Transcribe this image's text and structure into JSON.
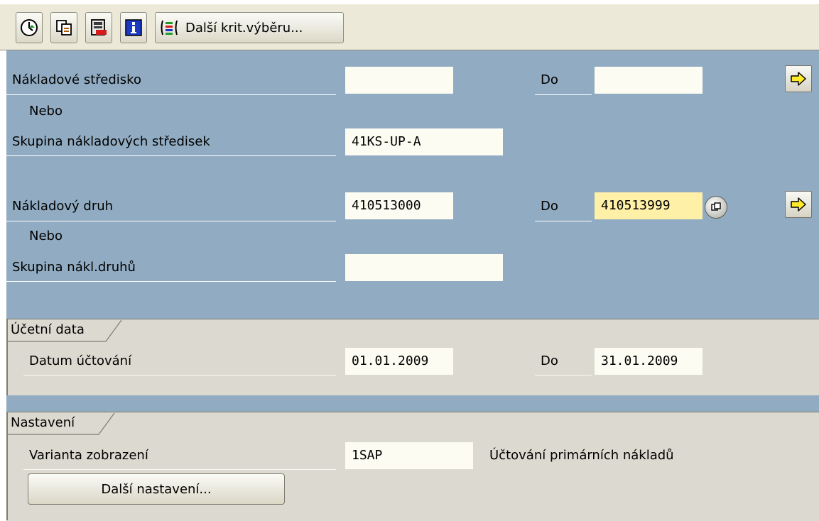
{
  "toolbar": {
    "buttons": [
      {
        "icon": "execute-clock-icon"
      },
      {
        "icon": "copy-variant-icon"
      },
      {
        "icon": "save-variant-icon"
      },
      {
        "icon": "info-icon"
      }
    ],
    "dynamic_selection_label": "Další krit.výběru..."
  },
  "selection": {
    "cost_center": {
      "label": "Nákladové středisko",
      "from": "",
      "to_label": "Do",
      "to": ""
    },
    "or1": "Nebo",
    "cost_center_group": {
      "label": "Skupina nákladových středisek",
      "value": "41KS-UP-A"
    },
    "cost_element": {
      "label": "Nákladový druh",
      "from": "410513000",
      "to_label": "Do",
      "to": "410513999"
    },
    "or2": "Nebo",
    "cost_element_group": {
      "label": "Skupina nákl.druhů",
      "value": ""
    }
  },
  "posting": {
    "group_title": "Účetní data",
    "posting_date": {
      "label": "Datum účtování",
      "from": "01.01.2009",
      "to_label": "Do",
      "to": "31.01.2009"
    }
  },
  "settings": {
    "group_title": "Nastavení",
    "layout": {
      "label": "Varianta zobrazení",
      "value": "1SAP",
      "description": "Účtování primárních nákladů"
    },
    "more_settings_button": "Další nastavení..."
  },
  "colors": {
    "selection_bg": "#91acc2",
    "group_bg": "#dcdad0",
    "field_bg": "#fcfcf2",
    "highlight_field": "#fff0a8"
  }
}
